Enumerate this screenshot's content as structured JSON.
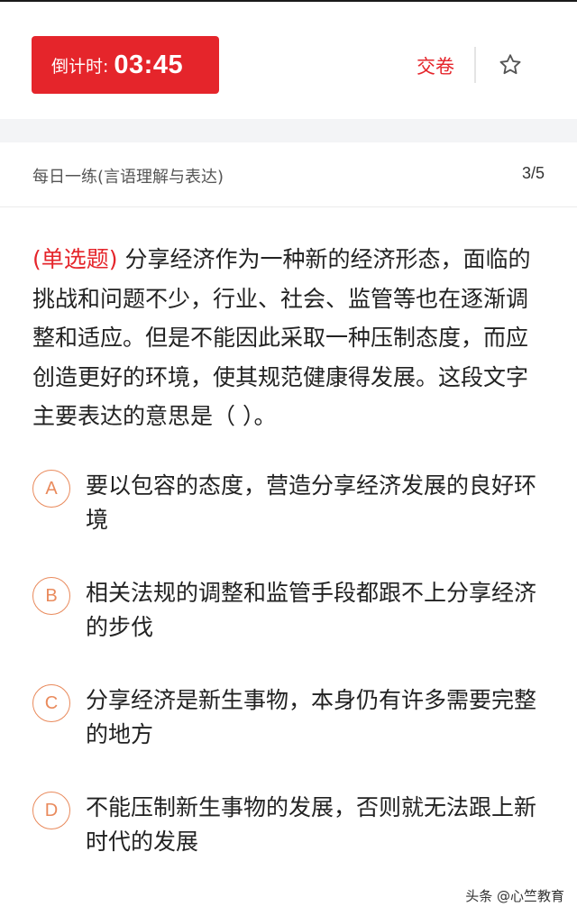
{
  "header": {
    "timer_label": "倒计时:",
    "timer_value": "03:45",
    "submit_label": "交卷",
    "star_icon": "star-outline-icon",
    "accent_color": "#e5252b"
  },
  "subheader": {
    "title": "每日一练(言语理解与表达)",
    "progress": "3/5"
  },
  "question": {
    "type": "(单选题)",
    "text": " 分享经济作为一种新的经济形态，面临的挑战和问题不少，行业、社会、监管等也在逐渐调整和适应。但是不能因此采取一种压制态度，而应创造更好的环境，使其规范健康得发展。这段文字主要表达的意思是（   ）。"
  },
  "options": [
    {
      "letter": "A",
      "text": "要以包容的态度，营造分享经济发展的良好环境"
    },
    {
      "letter": "B",
      "text": "相关法规的调整和监管手段都跟不上分享经济的步伐"
    },
    {
      "letter": "C",
      "text": "分享经济是新生事物，本身仍有许多需要完整的地方"
    },
    {
      "letter": "D",
      "text": "不能压制新生事物的发展，否则就无法跟上新时代的发展"
    }
  ],
  "watermark": "头条 @心竺教育"
}
